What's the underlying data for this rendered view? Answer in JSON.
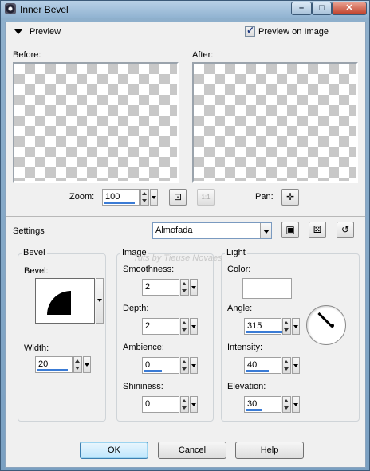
{
  "window": {
    "title": "Inner Bevel",
    "minimize_glyph": "–",
    "maximize_glyph": "□",
    "close_glyph": "✕"
  },
  "preview": {
    "section_label": "Preview",
    "preview_on_image_label": "Preview on Image",
    "preview_on_image_checked": true,
    "before_label": "Before:",
    "after_label": "After:",
    "zoom_label": "Zoom:",
    "zoom_value": "100",
    "pan_label": "Pan:",
    "pan_glyph": "✛",
    "one_to_one_label": "1:1"
  },
  "settings": {
    "label": "Settings",
    "preset": "Almofada"
  },
  "bevel": {
    "group_title": "Bevel",
    "bevel_label": "Bevel:",
    "width_label": "Width:",
    "width_value": "20"
  },
  "image": {
    "group_title": "Image",
    "smoothness_label": "Smoothness:",
    "smoothness_value": "2",
    "depth_label": "Depth:",
    "depth_value": "2",
    "ambience_label": "Ambience:",
    "ambience_value": "0",
    "shininess_label": "Shininess:",
    "shininess_value": "0"
  },
  "light": {
    "group_title": "Light",
    "color_label": "Color:",
    "color_value": "#ffffff",
    "angle_label": "Angle:",
    "angle_value": "315",
    "intensity_label": "Intensity:",
    "intensity_value": "40",
    "elevation_label": "Elevation:",
    "elevation_value": "30"
  },
  "watermark": "Tuts by Tieuse Novaes",
  "buttons": {
    "ok": "OK",
    "cancel": "Cancel",
    "help": "Help"
  }
}
